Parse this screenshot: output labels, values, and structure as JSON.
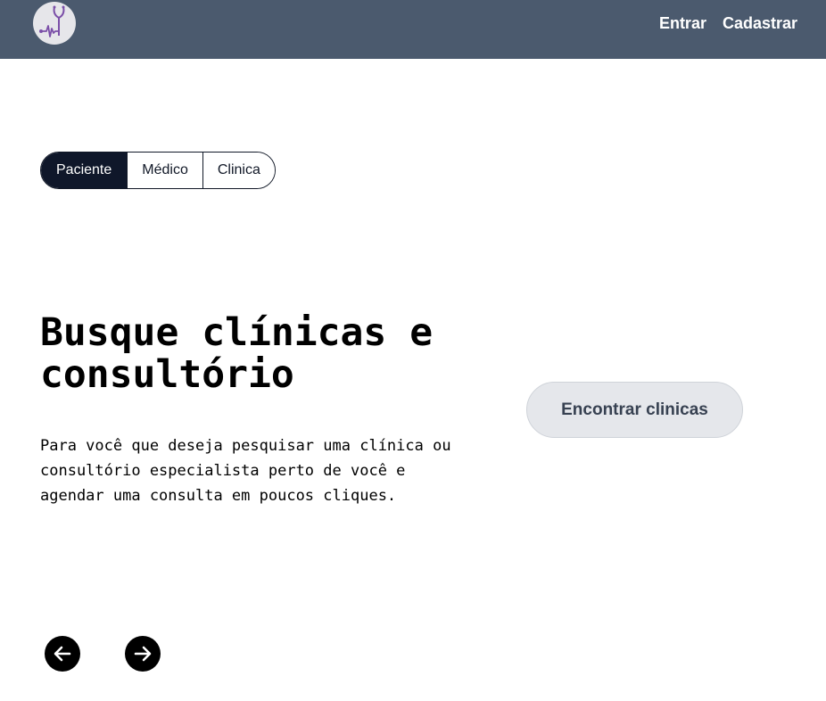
{
  "header": {
    "logo_icon": "stethoscope-heartbeat-logo",
    "nav": [
      {
        "label": "Entrar"
      },
      {
        "label": "Cadastrar"
      }
    ],
    "background_color": "#4b5a6e"
  },
  "role_tabs": {
    "items": [
      {
        "label": "Paciente",
        "active": true
      },
      {
        "label": "Médico",
        "active": false
      },
      {
        "label": "Clinica",
        "active": false
      }
    ]
  },
  "slide": {
    "title": "Busque clínicas e consultório",
    "description": "Para você que deseja pesquisar uma clínica ou consultório especialista perto de você e agendar uma consulta em poucos cliques.",
    "cta_label": "Encontrar clinicas"
  },
  "carousel": {
    "prev_icon": "arrow-left-icon",
    "next_icon": "arrow-right-icon"
  },
  "colors": {
    "active_tab": "#0f172a",
    "cta_background": "#e5e7eb",
    "cta_text": "#374151",
    "logo_accent": "#7b4fa8"
  }
}
